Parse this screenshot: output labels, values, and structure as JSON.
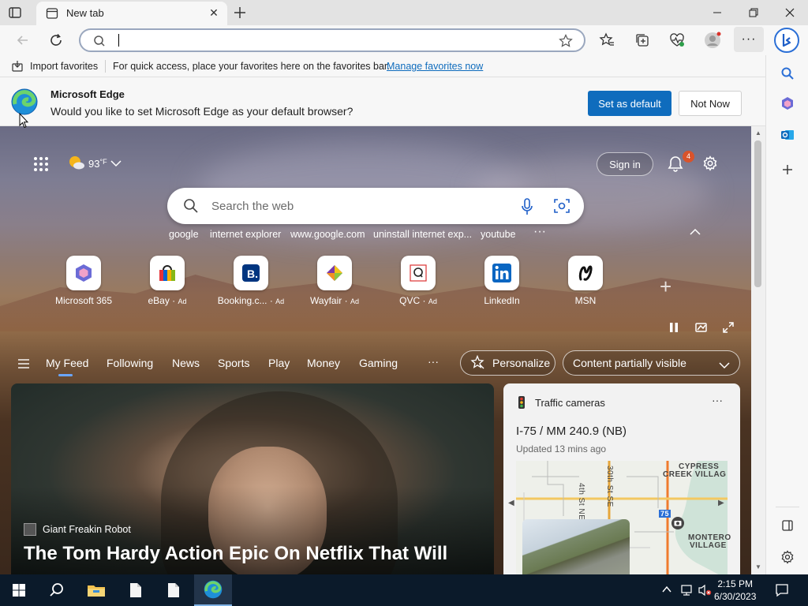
{
  "tab": {
    "title": "New tab",
    "close_label": "✕"
  },
  "omnibox": {
    "value": ""
  },
  "favorites_bar": {
    "import_label": "Import favorites",
    "message": "For quick access, place your favorites here on the favorites bar.",
    "link": "Manage favorites now"
  },
  "infobar": {
    "title": "Microsoft Edge",
    "message": "Would you like to set Microsoft Edge as your default browser?",
    "primary": "Set as default",
    "secondary": "Not Now"
  },
  "ntp": {
    "weather": {
      "temp": "93",
      "unit": "°F"
    },
    "signin": "Sign in",
    "notifications_count": "4",
    "search_placeholder": "Search the web",
    "trending": [
      "google",
      "internet explorer",
      "www.google.com",
      "uninstall internet exp...",
      "youtube"
    ],
    "quick_links": [
      {
        "name": "Microsoft 365",
        "ad": ""
      },
      {
        "name": "eBay",
        "ad": "Ad"
      },
      {
        "name": "Booking.c...",
        "ad": "Ad"
      },
      {
        "name": "Wayfair",
        "ad": "Ad"
      },
      {
        "name": "QVC",
        "ad": "Ad"
      },
      {
        "name": "LinkedIn",
        "ad": ""
      },
      {
        "name": "MSN",
        "ad": ""
      }
    ],
    "feed_tabs": [
      "My Feed",
      "Following",
      "News",
      "Sports",
      "Play",
      "Money",
      "Gaming"
    ],
    "personalize": "Personalize",
    "visibility": "Content partially visible",
    "hero": {
      "source": "Giant Freakin Robot",
      "headline": "The Tom Hardy Action Epic On Netflix That Will"
    },
    "traffic": {
      "title": "Traffic cameras",
      "location": "I-75 / MM 240.9 (NB)",
      "updated": "Updated 13 mins ago",
      "map_labels": [
        "CYPRESS",
        "CREEK VILLAG",
        "30th St SE",
        "4th St NE",
        "MONTERO",
        "VILLAGE",
        "75"
      ]
    }
  },
  "taskbar": {
    "time": "2:15 PM",
    "date": "6/30/2023"
  },
  "colors": {
    "accent": "#0f6cbd",
    "taskbar": "#0b1a2a",
    "badge": "#d9532b"
  }
}
